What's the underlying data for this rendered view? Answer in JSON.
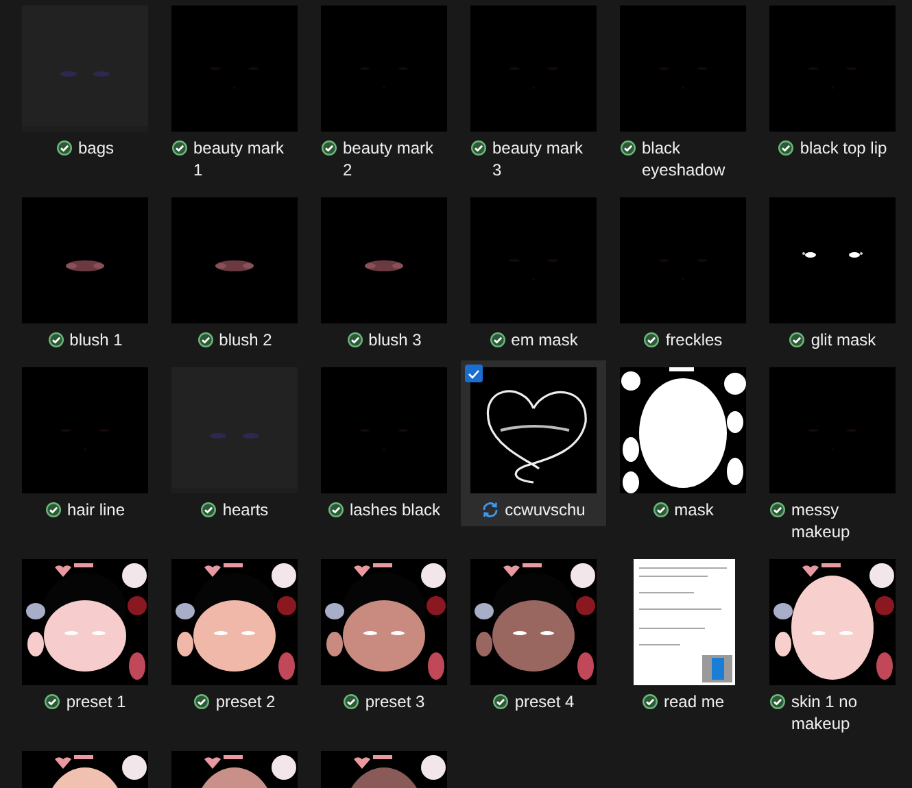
{
  "files": [
    {
      "name": "bags",
      "syncing": false,
      "selected": false,
      "thumbnail": {
        "kind": "clear"
      }
    },
    {
      "name": "beauty mark 1",
      "syncing": false,
      "selected": false,
      "thumbnail": {
        "kind": "dark"
      }
    },
    {
      "name": "beauty mark 2",
      "syncing": false,
      "selected": false,
      "thumbnail": {
        "kind": "dark"
      }
    },
    {
      "name": "beauty mark 3",
      "syncing": false,
      "selected": false,
      "thumbnail": {
        "kind": "dark"
      }
    },
    {
      "name": "black eyeshadow",
      "syncing": false,
      "selected": false,
      "thumbnail": {
        "kind": "dark"
      }
    },
    {
      "name": "black top lip",
      "syncing": false,
      "selected": false,
      "thumbnail": {
        "kind": "dark"
      }
    },
    {
      "name": "blush 1",
      "syncing": false,
      "selected": false,
      "thumbnail": {
        "kind": "blush"
      }
    },
    {
      "name": "blush 2",
      "syncing": false,
      "selected": false,
      "thumbnail": {
        "kind": "blush"
      }
    },
    {
      "name": "blush 3",
      "syncing": false,
      "selected": false,
      "thumbnail": {
        "kind": "blush"
      }
    },
    {
      "name": "em mask",
      "syncing": false,
      "selected": false,
      "thumbnail": {
        "kind": "dark"
      }
    },
    {
      "name": "freckles",
      "syncing": false,
      "selected": false,
      "thumbnail": {
        "kind": "dark"
      }
    },
    {
      "name": "glit mask",
      "syncing": false,
      "selected": false,
      "thumbnail": {
        "kind": "sparkle"
      }
    },
    {
      "name": "hair line",
      "syncing": false,
      "selected": false,
      "thumbnail": {
        "kind": "dark"
      }
    },
    {
      "name": "hearts",
      "syncing": false,
      "selected": false,
      "thumbnail": {
        "kind": "clear"
      }
    },
    {
      "name": "lashes black",
      "syncing": false,
      "selected": false,
      "thumbnail": {
        "kind": "dark"
      }
    },
    {
      "name": "ccwuvschu",
      "syncing": true,
      "selected": true,
      "thumbnail": {
        "kind": "logo"
      }
    },
    {
      "name": "mask",
      "syncing": false,
      "selected": false,
      "thumbnail": {
        "kind": "mask"
      }
    },
    {
      "name": "messy makeup",
      "syncing": false,
      "selected": false,
      "thumbnail": {
        "kind": "dark"
      }
    },
    {
      "name": "preset 1",
      "syncing": false,
      "selected": false,
      "thumbnail": {
        "kind": "face",
        "color": "#f6cccc"
      }
    },
    {
      "name": "preset 2",
      "syncing": false,
      "selected": false,
      "thumbnail": {
        "kind": "face",
        "color": "#f0b8a8"
      }
    },
    {
      "name": "preset 3",
      "syncing": false,
      "selected": false,
      "thumbnail": {
        "kind": "face",
        "color": "#c98a80"
      }
    },
    {
      "name": "preset 4",
      "syncing": false,
      "selected": false,
      "thumbnail": {
        "kind": "face",
        "color": "#9a6660"
      }
    },
    {
      "name": "read me",
      "syncing": false,
      "selected": false,
      "thumbnail": {
        "kind": "document"
      }
    },
    {
      "name": "skin 1 no makeup",
      "syncing": false,
      "selected": false,
      "thumbnail": {
        "kind": "skin",
        "color": "#f7cfcc"
      }
    },
    {
      "thumbnail": {
        "kind": "skin",
        "color": "#f0c0b0"
      }
    },
    {
      "thumbnail": {
        "kind": "skin",
        "color": "#c89088"
      }
    },
    {
      "thumbnail": {
        "kind": "skin",
        "color": "#8a5a58"
      }
    }
  ]
}
